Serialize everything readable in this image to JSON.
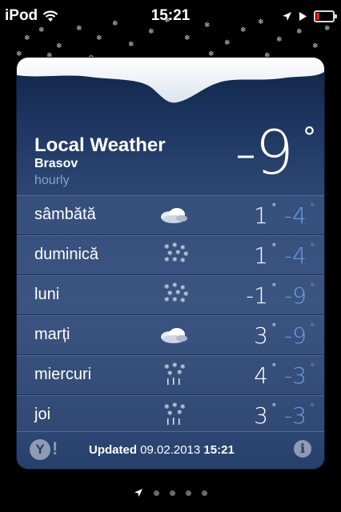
{
  "status": {
    "carrier": "iPod",
    "time": "15:21",
    "battery_color": "#e02020"
  },
  "widget": {
    "title": "Local Weather",
    "city": "Brasov",
    "mode": "hourly",
    "current_temp": "-9",
    "degree_symbol": "°"
  },
  "forecast": [
    {
      "day": "sâmbătă",
      "icon": "cloudy-icon",
      "hi": "1",
      "lo": "-4"
    },
    {
      "day": "duminică",
      "icon": "snow-icon",
      "hi": "1",
      "lo": "-4"
    },
    {
      "day": "luni",
      "icon": "snow-icon",
      "hi": "-1",
      "lo": "-9"
    },
    {
      "day": "marți",
      "icon": "cloudy-icon",
      "hi": "3",
      "lo": "-9"
    },
    {
      "day": "miercuri",
      "icon": "snow-showers-icon",
      "hi": "4",
      "lo": "-3"
    },
    {
      "day": "joi",
      "icon": "snow-showers-icon",
      "hi": "3",
      "lo": "-3"
    }
  ],
  "footer": {
    "yahoo_label": "Y",
    "yahoo_bang": "!",
    "updated_label": "Updated",
    "updated_date": "09.02.2013",
    "updated_time": "15:21",
    "info_label": "i"
  },
  "pager": {
    "page_count": 4,
    "current": 0
  }
}
